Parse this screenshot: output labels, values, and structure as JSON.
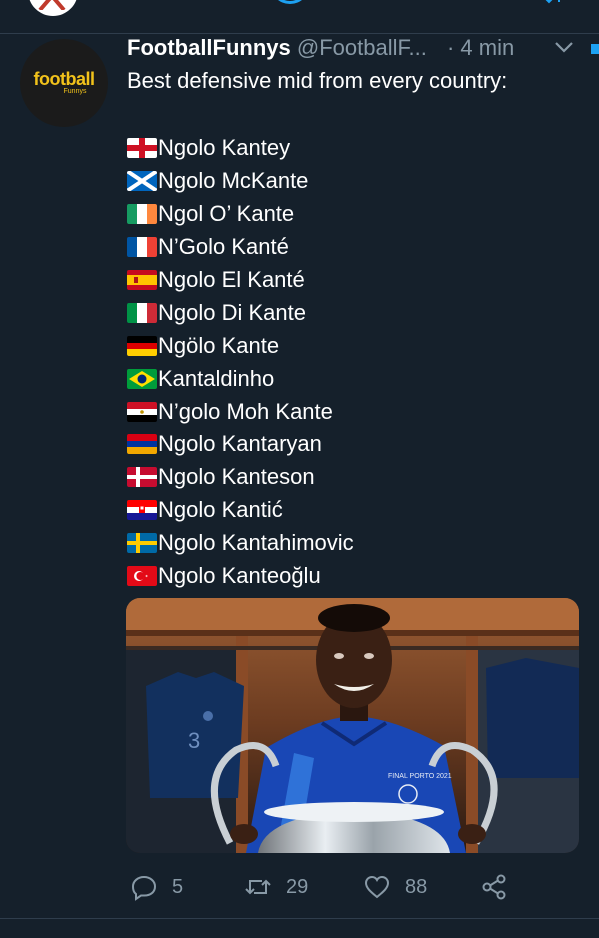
{
  "tweet": {
    "author_name": "FootballFunnys",
    "author_handle": "@FootballF...",
    "separator": "·",
    "time": "4 min",
    "avatar_logo_text": "football",
    "avatar_logo_sub": "Funnys",
    "intro": "Best defensive mid from every country:",
    "lines": [
      {
        "flag": "england",
        "text": "Ngolo Kantey"
      },
      {
        "flag": "scotland",
        "text": "Ngolo McKante"
      },
      {
        "flag": "ireland",
        "text": "Ngol O’ Kante"
      },
      {
        "flag": "france",
        "text": "N’Golo Kanté"
      },
      {
        "flag": "spain",
        "text": "Ngolo El Kanté"
      },
      {
        "flag": "italy",
        "text": "Ngolo Di Kante"
      },
      {
        "flag": "germany",
        "text": "Ngölo Kante"
      },
      {
        "flag": "brazil",
        "text": "Kantaldinho"
      },
      {
        "flag": "egypt",
        "text": "N’golo Moh Kante"
      },
      {
        "flag": "armenia",
        "text": "Ngolo Kantaryan"
      },
      {
        "flag": "denmark",
        "text": "Ngolo Kanteson"
      },
      {
        "flag": "croatia",
        "text": "Ngolo Kantić"
      },
      {
        "flag": "sweden",
        "text": "Ngolo Kantahimovic"
      },
      {
        "flag": "turkey",
        "text": "Ngolo Kanteoğlu"
      }
    ],
    "media": {
      "banner_text": "FINAL PORTO 2021",
      "shirt_number": "3"
    }
  },
  "actions": {
    "reply_count": "5",
    "retweet_count": "29",
    "like_count": "88",
    "icons": [
      "reply-icon",
      "retweet-icon",
      "like-icon",
      "share-icon"
    ]
  },
  "colors": {
    "background": "#15202b",
    "secondary_text": "#8899a6",
    "accent": "#1da1f2",
    "divider": "#2f3d4c"
  }
}
